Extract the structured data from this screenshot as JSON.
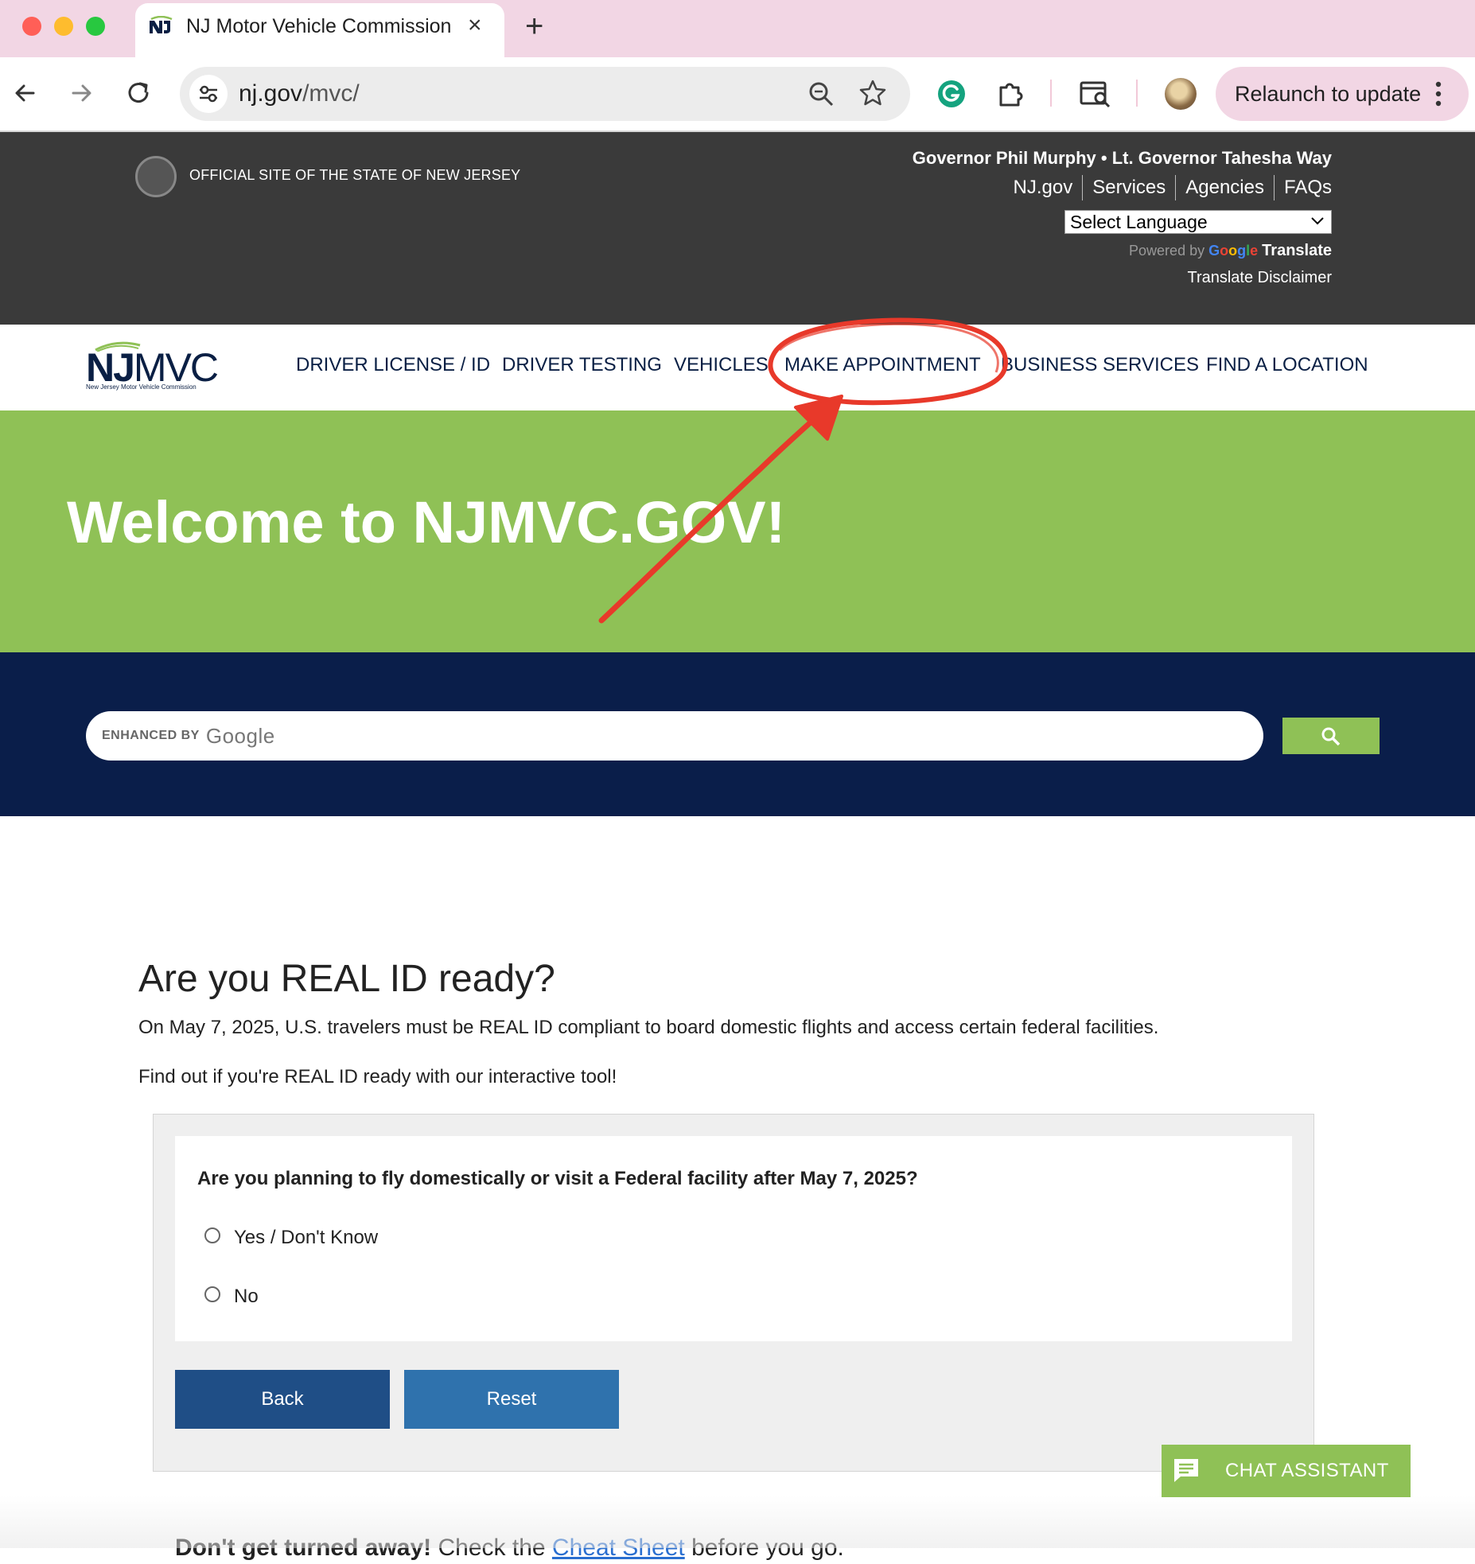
{
  "browser": {
    "tab_title": "NJ Motor Vehicle Commission",
    "tab_close": "×",
    "new_tab": "+",
    "url_domain": "nj.gov",
    "url_path": "/mvc/",
    "relaunch_label": "Relaunch to update",
    "colors": {
      "tabbar": "#f2d6e4",
      "red": "#ff5f57",
      "yellow": "#febc2e",
      "green": "#28c840"
    }
  },
  "header": {
    "official_site": "OFFICIAL SITE OF THE STATE OF NEW JERSEY",
    "governor": "Governor Phil Murphy • Lt. Governor Tahesha Way",
    "links": [
      "NJ.gov",
      "Services",
      "Agencies",
      "FAQs"
    ],
    "language_select": "Select Language",
    "powered_by": "Powered by",
    "google": "Google",
    "translate": "Translate",
    "translate_disclaimer": "Translate Disclaimer"
  },
  "nav": {
    "logo_nj": "NJ",
    "logo_mvc": "MVC",
    "logo_subtitle": "New Jersey Motor Vehicle Commission",
    "items": [
      "DRIVER LICENSE / ID",
      "DRIVER TESTING",
      "VEHICLES",
      "MAKE APPOINTMENT",
      "BUSINESS SERVICES",
      "FIND A LOCATION"
    ]
  },
  "hero": {
    "title": "Welcome to NJMVC.GOV!",
    "search_enhanced": "ENHANCED BY",
    "search_google": "Google",
    "colors": {
      "green": "#8fc156",
      "navy": "#0a1e4a"
    }
  },
  "realid": {
    "title": "Are you REAL ID ready?",
    "p1": "On May 7, 2025, U.S. travelers must be REAL ID compliant to board domestic flights and access certain federal facilities.",
    "p2": "Find out if you're REAL ID ready with our interactive tool!",
    "question": "Are you planning to fly domestically or visit a Federal facility after May 7, 2025?",
    "options": [
      "Yes / Don't Know",
      "No"
    ],
    "back_label": "Back",
    "reset_label": "Reset"
  },
  "chat": {
    "label": "CHAT ASSISTANT"
  },
  "bottom": {
    "bold": "Don't get turned away!",
    "pre": "Check the",
    "link": "Cheat Sheet",
    "post": "before you go."
  },
  "annotation": {
    "color": "#e8392a",
    "target": "MAKE APPOINTMENT"
  }
}
